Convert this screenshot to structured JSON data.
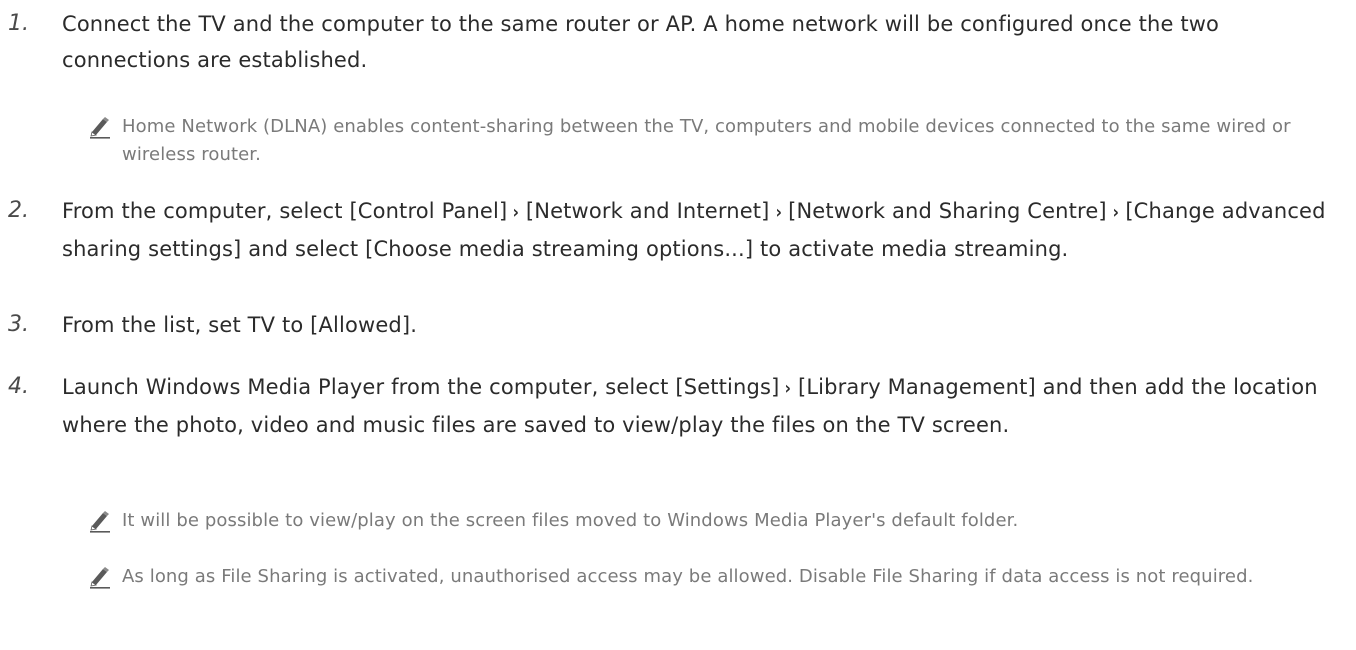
{
  "steps": [
    {
      "num": "1.",
      "text": "Connect the TV and the computer to the same router or AP. A home network will be configured once the two connections are established.",
      "notes": [
        "Home Network (DLNA) enables content-sharing between the TV, computers and mobile devices connected to the same wired or wireless router."
      ]
    },
    {
      "num": "2.",
      "parts": [
        "From the computer, select [Control Panel]",
        "[Network and Internet]",
        "[Network and Sharing Centre]",
        "[Change advanced sharing settings] and select [Choose media streaming options...] to activate media streaming."
      ],
      "separator": "›"
    },
    {
      "num": "3.",
      "text": "From the list, set TV to [Allowed]."
    },
    {
      "num": "4.",
      "parts": [
        "Launch Windows Media Player from the computer, select [Settings]",
        "[Library Management] and then add the location where the photo, video and music files are saved to view/play the files on the TV screen."
      ],
      "notes": [
        "It will be possible to view/play on the screen files moved to Windows Media Player's default folder.",
        "As long as File Sharing is activated, unauthorised access may be allowed. Disable File Sharing if data access is not required."
      ]
    }
  ],
  "icons": {
    "note": "pencil-note-icon"
  }
}
